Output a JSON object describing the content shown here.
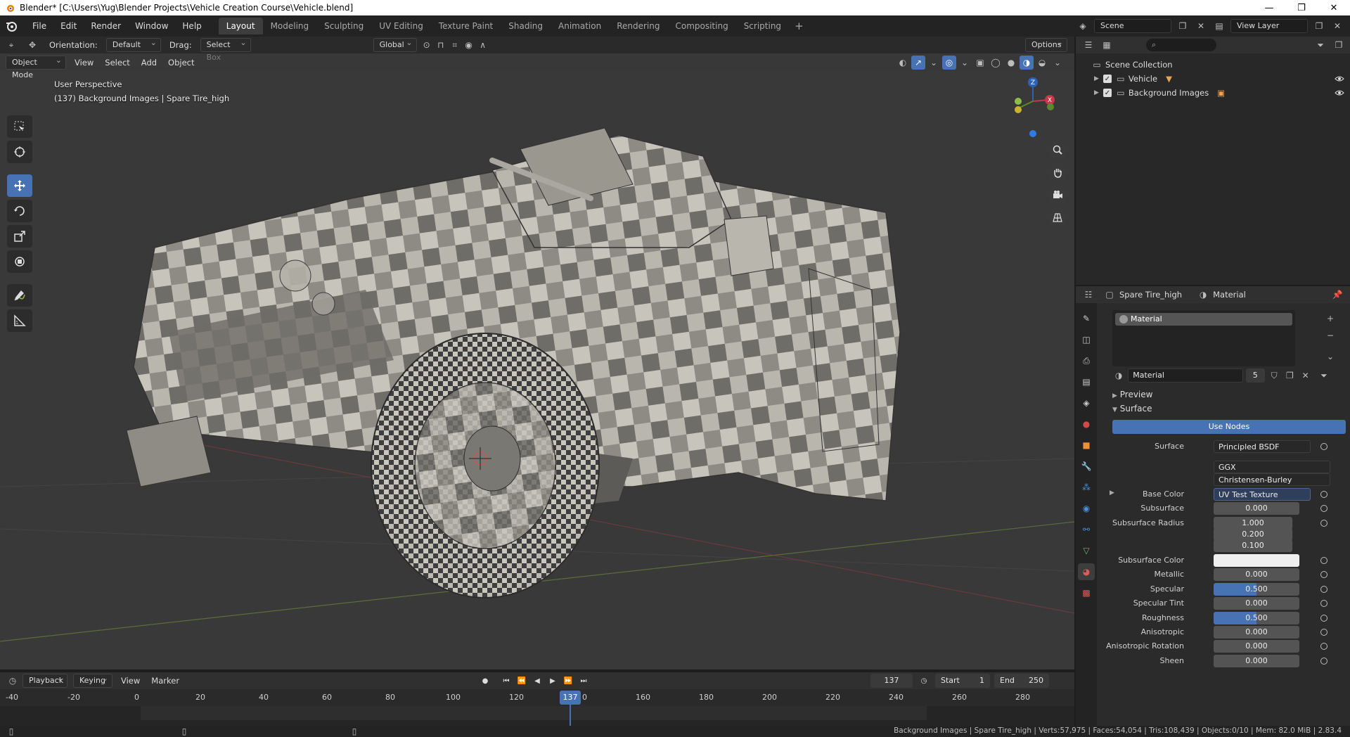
{
  "window": {
    "title": "Blender* [C:\\Users\\Yug\\Blender Projects\\Vehicle Creation Course\\Vehicle.blend]",
    "minimize": "—",
    "maximize": "❐",
    "close": "✕"
  },
  "menu": [
    "File",
    "Edit",
    "Render",
    "Window",
    "Help"
  ],
  "workspaces": [
    "Layout",
    "Modeling",
    "Sculpting",
    "UV Editing",
    "Texture Paint",
    "Shading",
    "Animation",
    "Rendering",
    "Compositing",
    "Scripting"
  ],
  "active_workspace": "Layout",
  "scene": {
    "scene_name": "Scene",
    "view_layer": "View Layer"
  },
  "viewport": {
    "orientation_label": "Orientation:",
    "orientation": "Default",
    "drag_label": "Drag:",
    "drag": "Select Box",
    "transform_space": "Global",
    "options": "Options",
    "mode": "Object Mode",
    "menus": [
      "View",
      "Select",
      "Add",
      "Object"
    ],
    "perspective": "User Perspective",
    "info": "(137) Background Images | Spare Tire_high",
    "gizmo_axes": {
      "z": "Z",
      "x": "X"
    }
  },
  "timeline": {
    "menus": [
      "Playback",
      "Keying",
      "View",
      "Marker"
    ],
    "current_frame": "137",
    "start_label": "Start",
    "start": "1",
    "end_label": "End",
    "end": "250",
    "ruler": [
      "-40",
      "-20",
      "0",
      "20",
      "40",
      "60",
      "80",
      "100",
      "120",
      "0",
      "160",
      "180",
      "200",
      "220",
      "240",
      "260",
      "280"
    ],
    "playhead": "137"
  },
  "outliner": {
    "root": "Scene Collection",
    "items": [
      {
        "label": "Vehicle"
      },
      {
        "label": "Background Images"
      }
    ]
  },
  "properties": {
    "object": "Spare Tire_high",
    "material_tab": "Material",
    "slot": "Material",
    "material_name": "Material",
    "users": "5",
    "preview_label": "Preview",
    "surface_panel": "Surface",
    "use_nodes": "Use Nodes",
    "rows": [
      {
        "label": "Surface",
        "value": "Principled BSDF",
        "kind": "wide"
      },
      {
        "label": "",
        "value": "GGX",
        "kind": "wide"
      },
      {
        "label": "",
        "value": "Christensen-Burley",
        "kind": "wide"
      },
      {
        "label": "Base Color",
        "value": "UV Test Texture",
        "kind": "link"
      },
      {
        "label": "Subsurface",
        "value": "0.000",
        "kind": "num"
      },
      {
        "label": "Subsurface Radius",
        "value": "1.000",
        "kind": "num"
      },
      {
        "label": "",
        "value": "0.200",
        "kind": "num"
      },
      {
        "label": "",
        "value": "0.100",
        "kind": "num"
      },
      {
        "label": "Subsurface Color",
        "value": "",
        "kind": "white"
      },
      {
        "label": "Metallic",
        "value": "0.000",
        "kind": "num"
      },
      {
        "label": "Specular",
        "value": "0.500",
        "kind": "blue"
      },
      {
        "label": "Specular Tint",
        "value": "0.000",
        "kind": "num"
      },
      {
        "label": "Roughness",
        "value": "0.500",
        "kind": "blue"
      },
      {
        "label": "Anisotropic",
        "value": "0.000",
        "kind": "num"
      },
      {
        "label": "Anisotropic Rotation",
        "value": "0.000",
        "kind": "num"
      },
      {
        "label": "Sheen",
        "value": "0.000",
        "kind": "num"
      }
    ]
  },
  "status": {
    "stats": "Background Images | Spare Tire_high | Verts:57,975 | Faces:54,054 | Tris:108,439 | Objects:0/10 | Mem: 82.0 MiB | 2.83.4"
  },
  "colors": {
    "accent": "#4772b3",
    "viewport_bg": "#393939",
    "header_bg": "#303030",
    "panel_bg": "#2b2b2b",
    "blender_orange": "#e87d0d"
  }
}
